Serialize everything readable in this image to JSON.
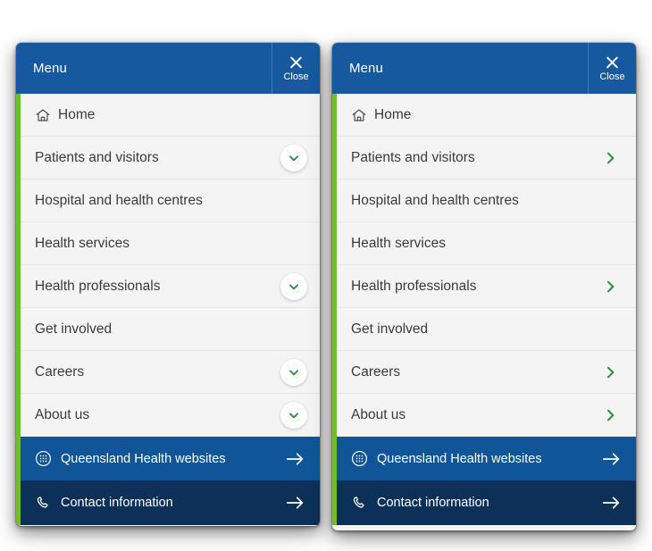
{
  "header": {
    "title": "Menu",
    "close_label": "Close",
    "close_icon": "close-x-icon"
  },
  "colors": {
    "header_blue": "#17599f",
    "green_rail": "#6fbe2b",
    "chevron_green": "#2e8b3d",
    "websites_row_blue": "#0f5598",
    "contact_row_navy": "#0c3057",
    "list_background": "#f4f4f4",
    "divider": "#e7e7e7",
    "label_text": "#3b3b3b"
  },
  "panels": [
    {
      "variant": "circle-chevron",
      "items": [
        {
          "label": "Home",
          "icon": "home-icon",
          "indicator": "none"
        },
        {
          "label": "Patients and visitors",
          "icon": "",
          "indicator": "chevron-down-circle"
        },
        {
          "label": "Hospital and health centres",
          "icon": "",
          "indicator": "none"
        },
        {
          "label": "Health services",
          "icon": "",
          "indicator": "none"
        },
        {
          "label": "Health professionals",
          "icon": "",
          "indicator": "chevron-down-circle"
        },
        {
          "label": "Get involved",
          "icon": "",
          "indicator": "none"
        },
        {
          "label": "Careers",
          "icon": "",
          "indicator": "chevron-down-circle"
        },
        {
          "label": "About us",
          "icon": "",
          "indicator": "chevron-down-circle"
        }
      ],
      "features": [
        {
          "label": "Queensland Health websites",
          "icon": "grid-circle-icon",
          "indicator": "arrow-right-icon",
          "style": "websites"
        },
        {
          "label": "Contact information",
          "icon": "phone-icon",
          "indicator": "arrow-right-icon",
          "style": "contact"
        }
      ]
    },
    {
      "variant": "plain-chevron",
      "items": [
        {
          "label": "Home",
          "icon": "home-icon",
          "indicator": "none"
        },
        {
          "label": "Patients and visitors",
          "icon": "",
          "indicator": "chevron-right"
        },
        {
          "label": "Hospital and health centres",
          "icon": "",
          "indicator": "none"
        },
        {
          "label": "Health services",
          "icon": "",
          "indicator": "none"
        },
        {
          "label": "Health professionals",
          "icon": "",
          "indicator": "chevron-right"
        },
        {
          "label": "Get involved",
          "icon": "",
          "indicator": "none"
        },
        {
          "label": "Careers",
          "icon": "",
          "indicator": "chevron-right"
        },
        {
          "label": "About us",
          "icon": "",
          "indicator": "chevron-right"
        }
      ],
      "features": [
        {
          "label": "Queensland Health websites",
          "icon": "grid-circle-icon",
          "indicator": "arrow-right-icon",
          "style": "websites"
        },
        {
          "label": "Contact information",
          "icon": "phone-icon",
          "indicator": "arrow-right-icon",
          "style": "contact"
        }
      ]
    }
  ]
}
